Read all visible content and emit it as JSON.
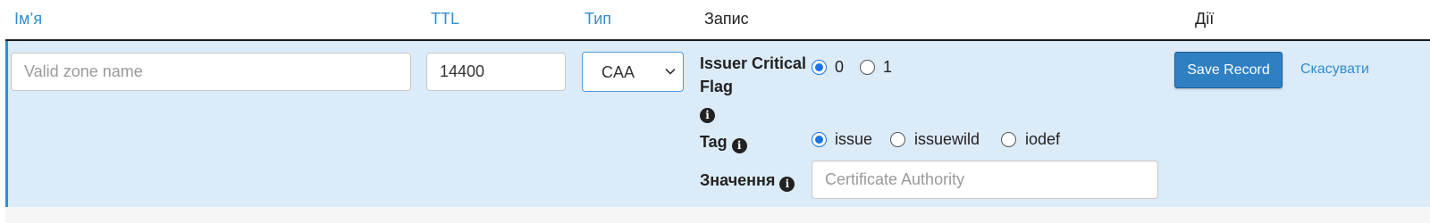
{
  "header": {
    "name": "Ім’я",
    "ttl": "TTL",
    "type": "Тип",
    "record": "Запис",
    "actions": "Дії"
  },
  "form": {
    "name_placeholder": "Valid zone name",
    "ttl_value": "14400",
    "type_selected": "CAA",
    "issuer_flag_label_line1": "Issuer Critical",
    "issuer_flag_label_line2": "Flag",
    "issuer_flag_options": [
      "0",
      "1"
    ],
    "issuer_flag_selected": "0",
    "tag_label": "Tag",
    "tag_options": [
      "issue",
      "issuewild",
      "iodef"
    ],
    "tag_selected": "issue",
    "value_label": "Значення",
    "value_placeholder": "Certificate Authority",
    "info_glyph": "i"
  },
  "actions": {
    "save_label": "Save Record",
    "cancel_label": "Скасувати"
  },
  "colors": {
    "accent": "#2f8fcf",
    "row_background": "#dcebf8",
    "save_button": "#2f7fc3",
    "radio_checked": "#1a73e8"
  }
}
